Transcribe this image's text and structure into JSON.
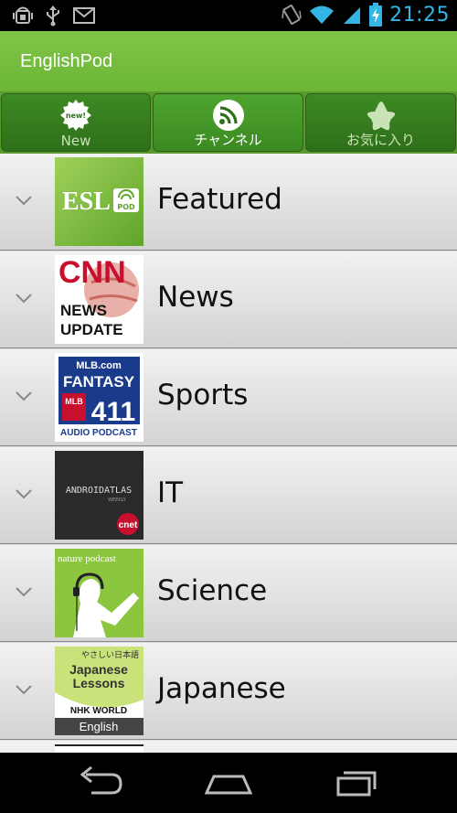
{
  "status_bar": {
    "time": "21:25",
    "icons": [
      "android-debug-icon",
      "usb-icon",
      "gmail-icon",
      "vibrate-icon",
      "wifi-icon",
      "signal-icon",
      "battery-charging-icon"
    ]
  },
  "app": {
    "title": "EnglishPod"
  },
  "tabs": [
    {
      "label": "New",
      "icon": "new-badge-icon",
      "active": false,
      "badge_text": "new!"
    },
    {
      "label": "チャンネル",
      "icon": "rss-icon",
      "active": true
    },
    {
      "label": "お気に入り",
      "icon": "star-icon",
      "active": false
    }
  ],
  "channels": [
    {
      "label": "Featured",
      "thumb": "esl-pod-logo",
      "thumb_text": [
        "ESL",
        "POD"
      ]
    },
    {
      "label": "News",
      "thumb": "cnn-news-update-logo",
      "thumb_text": [
        "CNN",
        "NEWS",
        "UPDATE"
      ]
    },
    {
      "label": "Sports",
      "thumb": "mlb-fantasy-411-logo",
      "thumb_text": [
        "MLB.com",
        "FANTASY",
        "MLB",
        "411",
        "AUDIO PODCAST"
      ]
    },
    {
      "label": "IT",
      "thumb": "android-atlas-logo",
      "thumb_text": [
        "ANDROIDATLAS",
        "WEEKLY",
        "cnet"
      ]
    },
    {
      "label": "Science",
      "thumb": "nature-podcast-logo",
      "thumb_text": [
        "nature podcast"
      ]
    },
    {
      "label": "Japanese",
      "thumb": "nhk-japanese-lessons-logo",
      "thumb_text": [
        "やさしい日本語",
        "Japanese",
        "Lessons",
        "NHK WORLD",
        "English"
      ]
    }
  ],
  "colors": {
    "action_bar": "#7bc043",
    "tab_bg": "#2e6f19",
    "time": "#33b5e5"
  },
  "nav_bar": {
    "buttons": [
      "back-icon",
      "home-icon",
      "recent-apps-icon"
    ]
  }
}
